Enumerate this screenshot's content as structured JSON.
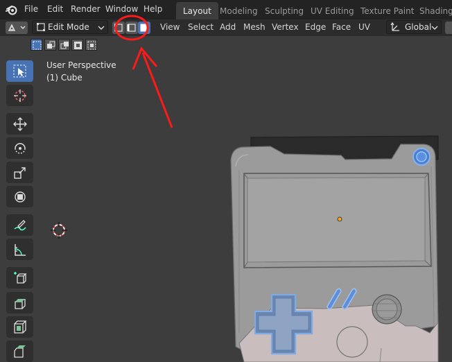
{
  "topbar": {
    "menus": [
      "File",
      "Edit",
      "Render",
      "Window",
      "Help"
    ],
    "workspaces": [
      {
        "label": "Layout",
        "active": true
      },
      {
        "label": "Modeling",
        "active": false
      },
      {
        "label": "Sculpting",
        "active": false
      },
      {
        "label": "UV Editing",
        "active": false
      },
      {
        "label": "Texture Paint",
        "active": false
      },
      {
        "label": "Shading",
        "active": false
      }
    ]
  },
  "header": {
    "mode": "Edit Mode",
    "menus": [
      "View",
      "Select",
      "Add",
      "Mesh",
      "Vertex",
      "Edge",
      "Face",
      "UV"
    ],
    "transform_orientation": "Global"
  },
  "viewport": {
    "perspective_label": "User Perspective",
    "object_label": "(1) Cube"
  },
  "colors": {
    "accent": "#4772b3",
    "annotation": "#ff1a1a"
  }
}
